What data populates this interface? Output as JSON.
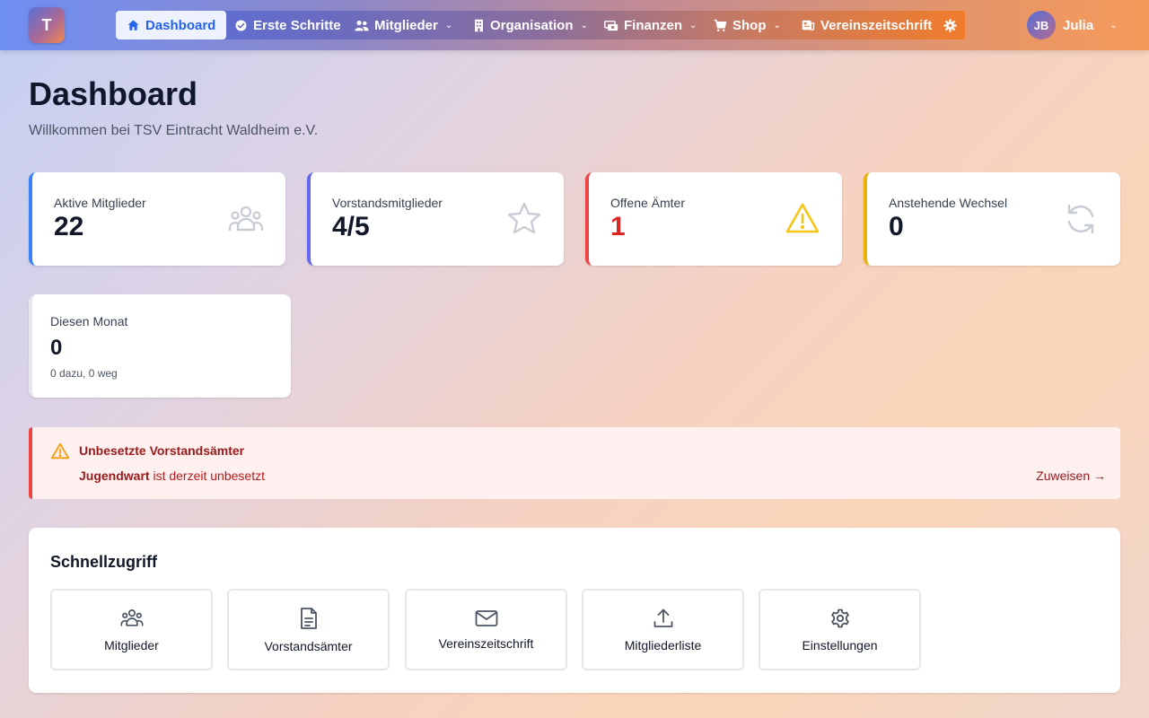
{
  "brand": {
    "logo_letter": "T"
  },
  "nav": {
    "items": [
      {
        "label": "Dashboard",
        "icon": "home-icon",
        "active": true,
        "dropdown": false
      },
      {
        "label": "Erste Schritte",
        "icon": "check-circle-icon",
        "dropdown": false
      },
      {
        "label": "Mitglieder",
        "icon": "users-icon",
        "dropdown": true
      },
      {
        "label": "Organisation",
        "icon": "building-icon",
        "dropdown": true
      },
      {
        "label": "Finanzen",
        "icon": "money-icon",
        "dropdown": true
      },
      {
        "label": "Shop",
        "icon": "cart-icon",
        "dropdown": true
      },
      {
        "label": "Vereinszeitschrift",
        "icon": "newspaper-icon",
        "dropdown": false
      }
    ],
    "settings_icon": "gear-icon"
  },
  "user": {
    "initials": "JB",
    "name": "Julia"
  },
  "header": {
    "title": "Dashboard",
    "subtitle": "Willkommen bei TSV Eintracht Waldheim e.V."
  },
  "stats": [
    {
      "label": "Aktive Mitglieder",
      "value": "22",
      "icon": "users-icon",
      "accent": "#3b82f6"
    },
    {
      "label": "Vorstandsmitglieder",
      "value": "4/5",
      "icon": "star-icon",
      "accent": "#6366f1"
    },
    {
      "label": "Offene Ämter",
      "value": "1",
      "icon": "warning-icon",
      "accent": "#ef4444"
    },
    {
      "label": "Anstehende Wechsel",
      "value": "0",
      "icon": "refresh-icon",
      "accent": "#eab308"
    }
  ],
  "month": {
    "label": "Diesen Monat",
    "value": "0",
    "sub": "0 dazu, 0 weg"
  },
  "alert": {
    "title": "Unbesetzte Vorstandsämter",
    "role": "Jugendwart",
    "text": " ist derzeit unbesetzt",
    "link": "Zuweisen →"
  },
  "quick": {
    "title": "Schnellzugriff",
    "items": [
      {
        "label": "Mitglieder",
        "icon": "users-icon"
      },
      {
        "label": "Vorstandsämter",
        "icon": "document-icon"
      },
      {
        "label": "Vereinszeitschrift",
        "icon": "mail-icon"
      },
      {
        "label": "Mitgliederliste",
        "icon": "upload-icon"
      },
      {
        "label": "Einstellungen",
        "icon": "gear-icon"
      }
    ]
  }
}
